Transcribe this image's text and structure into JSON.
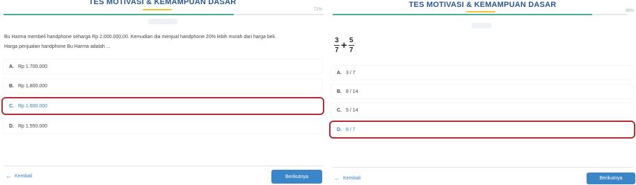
{
  "left": {
    "title": "TES MOTIVASI & KEMAMPUAN DASAR",
    "progress_label": "72%",
    "progress": 0.72,
    "question_line1": "Bu Harma membeli handphone seharga Rp 2.000.000,00. Kemudian dia menjual handphone 20% lebih murah dari harga beli.",
    "question_line2": "Harga penjualan handphone Bu Harma adalah ...",
    "options": [
      {
        "letter": "A.",
        "text": "Rp 1.700.000"
      },
      {
        "letter": "B.",
        "text": "Rp 1.800.000"
      },
      {
        "letter": "C.",
        "text": "Rp 1.600.000"
      },
      {
        "letter": "D.",
        "text": "Rp 1.550.000"
      }
    ],
    "selected_index": 2,
    "back_label": "Kembali",
    "next_label": "Berikutnya"
  },
  "right": {
    "title": "TES MOTIVASI & KEMAMPUAN DASAR",
    "progress_label": "88%",
    "progress": 0.88,
    "expression": {
      "a_num": "3",
      "a_den": "7",
      "op": "+",
      "b_num": "5",
      "b_den": "7"
    },
    "options": [
      {
        "letter": "A.",
        "text": "3 / 7"
      },
      {
        "letter": "B.",
        "text": "8 / 14"
      },
      {
        "letter": "C.",
        "text": "5 / 14"
      },
      {
        "letter": "D.",
        "text": "8 / 7"
      }
    ],
    "selected_index": 3,
    "back_label": "Kembali",
    "next_label": "Berikutnya"
  },
  "colors": {
    "accent_blue": "#3b86c8",
    "title_blue": "#2b5790",
    "progress_green": "#4aae8c",
    "underline_yellow": "#f1c232",
    "selection_red": "#b62b33"
  }
}
